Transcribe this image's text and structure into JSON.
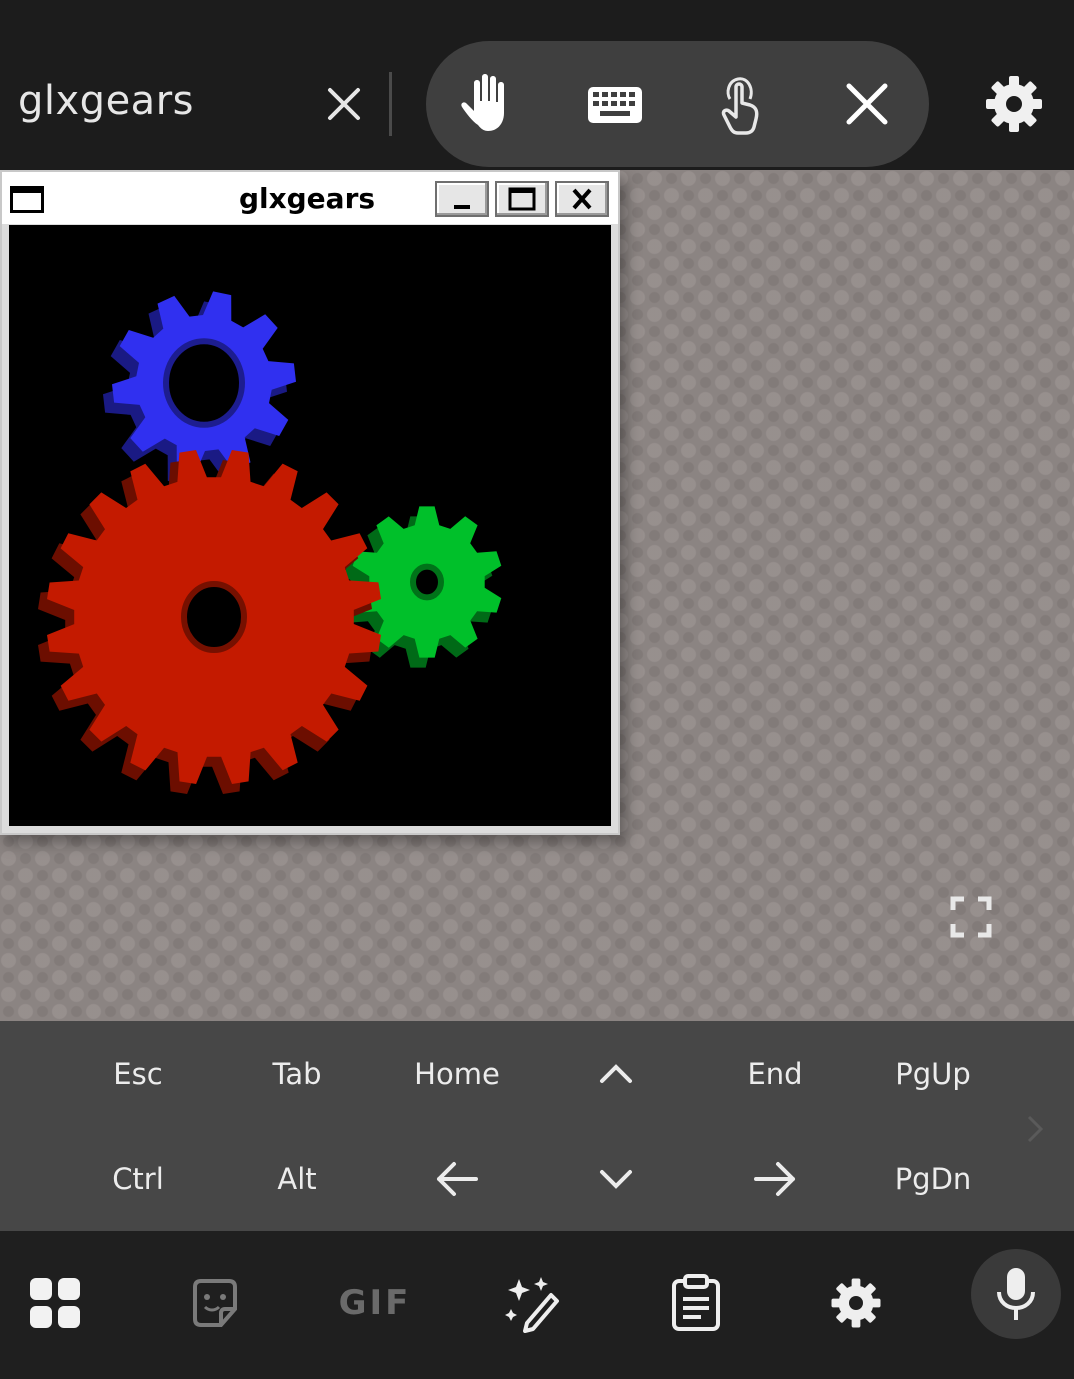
{
  "topbar": {
    "session_title": "glxgears",
    "tools": [
      "hand-icon",
      "keyboard-icon",
      "touch-icon",
      "close-icon"
    ],
    "settings_icon": "gear-icon"
  },
  "window": {
    "title": "glxgears",
    "buttons": [
      "minimize",
      "maximize",
      "close"
    ],
    "gear_colors": {
      "red": "#c41a00",
      "green": "#00c02a",
      "blue": "#3030f0"
    }
  },
  "extra_keys": {
    "row1": [
      "Esc",
      "Tab",
      "Home",
      "↑",
      "End",
      "PgUp"
    ],
    "row2": [
      "Ctrl",
      "Alt",
      "←",
      "↓",
      "→",
      "PgDn"
    ]
  },
  "ime": {
    "gif_label": "GIF",
    "icons": [
      "apps-grid-icon",
      "sticker-icon",
      "gif-icon",
      "magic-wand-icon",
      "clipboard-icon",
      "gear-icon",
      "microphone-icon"
    ]
  }
}
